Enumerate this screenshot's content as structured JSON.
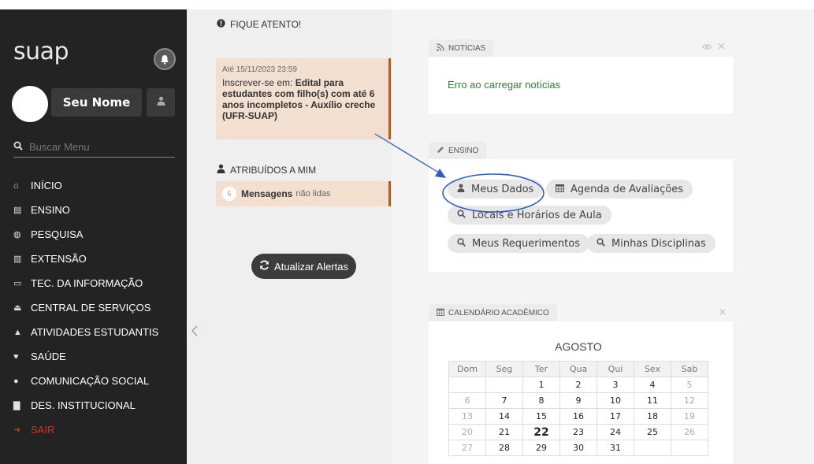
{
  "sidebar": {
    "logo": "suap",
    "user_name": "Seu Nome",
    "search_placeholder": "Buscar Menu",
    "menu": [
      {
        "label": "INÍCIO",
        "icon": "home-icon",
        "glyph": "⌂"
      },
      {
        "label": "ENSINO",
        "icon": "chalkboard-icon",
        "glyph": "▤"
      },
      {
        "label": "PESQUISA",
        "icon": "globe-icon",
        "glyph": "◍"
      },
      {
        "label": "EXTENSÃO",
        "icon": "building-icon",
        "glyph": "▥"
      },
      {
        "label": "TEC. DA INFORMAÇÃO",
        "icon": "laptop-icon",
        "glyph": "▭"
      },
      {
        "label": "CENTRAL DE SERVIÇOS",
        "icon": "eject-icon",
        "glyph": "⏏"
      },
      {
        "label": "ATIVIDADES ESTUDANTIS",
        "icon": "graduation-cap-icon",
        "glyph": "▲"
      },
      {
        "label": "SAÚDE",
        "icon": "heartbeat-icon",
        "glyph": "♥"
      },
      {
        "label": "COMUNICAÇÃO SOCIAL",
        "icon": "comment-icon",
        "glyph": "●"
      },
      {
        "label": "DES. INSTITUCIONAL",
        "icon": "chart-icon",
        "glyph": "▇"
      },
      {
        "label": "SAIR",
        "icon": "sign-out-icon",
        "glyph": "➜"
      }
    ]
  },
  "alerts": {
    "title": "FIQUE ATENTO!",
    "date": "Até 15/11/2023 23:59",
    "prefix": "Inscrever-se em: ",
    "bold_text": "Edital para estudantes com filho(s) com até 6 anos incompletos - Auxílio creche (UFR-SUAP)"
  },
  "assigned": {
    "title": "ATRIBUÍDOS A MIM",
    "count": "5",
    "label": "Mensagens",
    "suffix": "não lidas"
  },
  "refresh_label": "Atualizar Alertas",
  "news": {
    "tab": "NOTÍCIAS",
    "error": "Erro ao carregar notícias"
  },
  "ensino": {
    "tab": "ENSINO",
    "links": [
      {
        "label": "Meus Dados",
        "icon": "user-icon"
      },
      {
        "label": "Agenda de Avaliações",
        "icon": "calendar-icon"
      },
      {
        "label": "Locais e Horários de Aula",
        "icon": "search-icon"
      },
      {
        "label": "Meus Requerimentos",
        "icon": "search-icon"
      },
      {
        "label": "Minhas Disciplinas",
        "icon": "search-icon"
      }
    ]
  },
  "calendar": {
    "tab": "CALENDÁRIO ACADÊMICO",
    "month": "AGOSTO",
    "weekdays": [
      "Dom",
      "Seg",
      "Ter",
      "Qua",
      "Qui",
      "Sex",
      "Sab"
    ],
    "weeks": [
      [
        "",
        "",
        "1",
        "2",
        "3",
        "4",
        "5"
      ],
      [
        "6",
        "7",
        "8",
        "9",
        "10",
        "11",
        "12"
      ],
      [
        "13",
        "14",
        "15",
        "16",
        "17",
        "18",
        "19"
      ],
      [
        "20",
        "21",
        "22",
        "23",
        "24",
        "25",
        "26"
      ],
      [
        "27",
        "28",
        "29",
        "30",
        "31",
        "",
        ""
      ]
    ],
    "today": "22"
  },
  "colors": {
    "sidebar_bg": "#232323",
    "alert_bg": "#f2dfd0",
    "alert_border": "#d35400",
    "news_error": "#2e7d32",
    "annotation": "#2f5cc4"
  }
}
